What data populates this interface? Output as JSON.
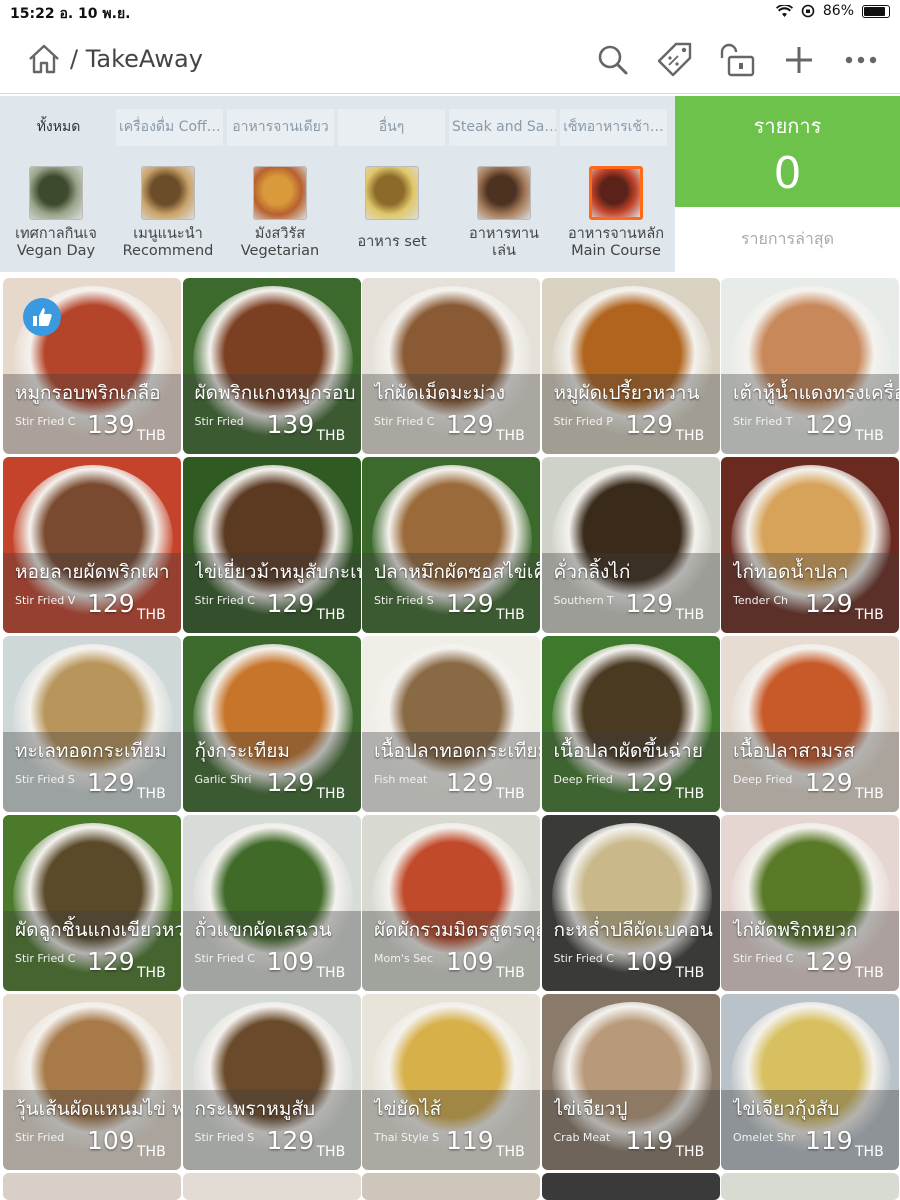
{
  "status": {
    "time_date": "15:22  อ. 10 พ.ย.",
    "battery": "86%"
  },
  "nav": {
    "breadcrumb": "/ TakeAway",
    "icons": [
      "home-icon",
      "search-icon",
      "tag-icon",
      "unlock-icon",
      "plus-icon",
      "more-icon"
    ]
  },
  "tabs": [
    "ทั้งหมด",
    "เครื่องดื่ม Coff…",
    "อาหารจานเดียว",
    "อื่นๆ",
    "Steak and Sa…",
    "เซ็ทอาหารเช้า…"
  ],
  "subcategories": [
    {
      "label": "เทศกาลกินเจ\nVegan Day",
      "selected": false
    },
    {
      "label": "เมนูแนะนำ\nRecommend",
      "selected": false
    },
    {
      "label": "มังสวิรัส\nVegetarian",
      "selected": false
    },
    {
      "label": "อาหาร set",
      "selected": false
    },
    {
      "label": "อาหารทาน\nเล่น",
      "selected": false
    },
    {
      "label": "อาหารจานหลัก\nMain Course",
      "selected": true
    }
  ],
  "order": {
    "title": "รายการ",
    "count": "0",
    "recent": "รายการล่าสุด"
  },
  "currency": "THB",
  "items": [
    {
      "name": "หมูกรอบพริกเกลือ",
      "sub": "Stir Fried C",
      "price": "139",
      "liked": true
    },
    {
      "name": "ผัดพริกแกงหมูกรอบ",
      "sub": "Stir Fried",
      "price": "139"
    },
    {
      "name": "ไก่ผัดเม็ดมะม่วง",
      "sub": "Stir Fried C",
      "price": "129"
    },
    {
      "name": "หมูผัดเปรี้ยวหวาน",
      "sub": "Stir Fried P",
      "price": "129"
    },
    {
      "name": "เต้าหู้น้ำแดงทรงเครื่อง",
      "sub": "Stir Fried T",
      "price": "129"
    },
    {
      "name": "หอยลายผัดพริกเผา",
      "sub": "Stir Fried V",
      "price": "129"
    },
    {
      "name": "ไข่เยี่ยวม้าหมูสับกะเพรา",
      "sub": "Stir Fried C",
      "price": "129"
    },
    {
      "name": "ปลาหมึกผัดซอสไข่เค็ม",
      "sub": "Stir Fried S",
      "price": "129"
    },
    {
      "name": "คั่วกลิ้งไก่",
      "sub": "Southern T",
      "price": "129"
    },
    {
      "name": "ไก่ทอดน้ำปลา",
      "sub": "Tender Ch",
      "price": "129"
    },
    {
      "name": "ทะเลทอดกระเทียม",
      "sub": "Stir Fried S",
      "price": "129"
    },
    {
      "name": "กุ้งกระเทียม",
      "sub": "Garlic Shri",
      "price": "129"
    },
    {
      "name": "เนื้อปลาทอดกระเทียมพริ",
      "sub": "Fish meat",
      "price": "129"
    },
    {
      "name": "เนื้อปลาผัดขึ้นฉ่าย",
      "sub": "Deep Fried",
      "price": "129"
    },
    {
      "name": "เนื้อปลาสามรส",
      "sub": "Deep Fried",
      "price": "129"
    },
    {
      "name": "ผัดลูกชิ้นแกงเขียวหวาน",
      "sub": "Stir Fried C",
      "price": "129"
    },
    {
      "name": "ถั่วแขกผัดเสฉวน",
      "sub": "Stir Fried C",
      "price": "109"
    },
    {
      "name": "ผัดผักรวมมิตรสูตรคุณแ",
      "sub": "Mom's Sec",
      "price": "109"
    },
    {
      "name": "กะหล่ำปลีผัดเบคอน",
      "sub": "Stir Fried C",
      "price": "109"
    },
    {
      "name": "ไก่ผัดพริกหยวก",
      "sub": "Stir Fried C",
      "price": "129"
    },
    {
      "name": "วุ้นเส้นผัดแหนมไข่ พริก",
      "sub": "Stir Fried",
      "price": "109"
    },
    {
      "name": "กระเพราหมูสับ",
      "sub": "Stir Fried S",
      "price": "129"
    },
    {
      "name": "ไข่ยัดไส้",
      "sub": "Thai Style S",
      "price": "119"
    },
    {
      "name": "ไข่เจียวปู",
      "sub": "Crab Meat",
      "price": "119"
    },
    {
      "name": "ไข่เจียวกุ้งสับ",
      "sub": "Omelet Shr",
      "price": "119"
    }
  ]
}
